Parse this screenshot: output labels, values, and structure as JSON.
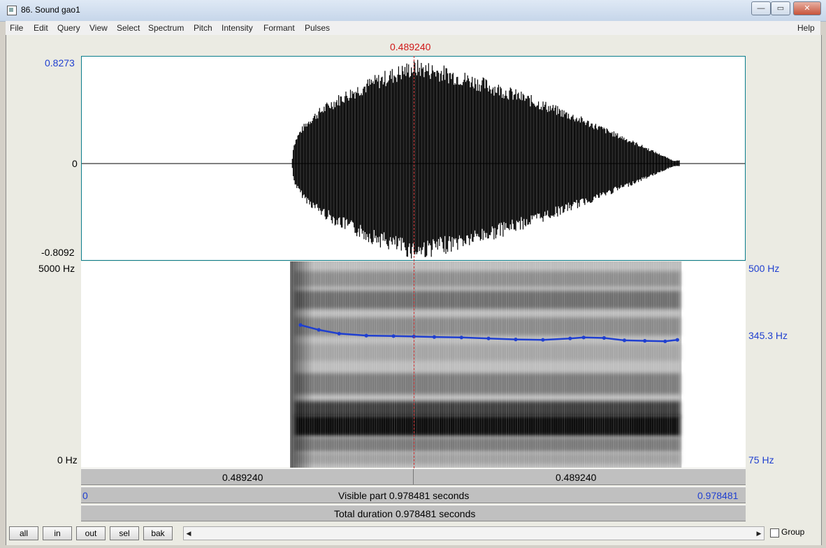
{
  "window": {
    "title": "86. Sound gao1",
    "controls": [
      "—",
      "▭",
      "✕"
    ]
  },
  "menu": {
    "items": [
      "File",
      "Edit",
      "Query",
      "View",
      "Select",
      "Spectrum",
      "Pitch",
      "Intensity",
      "Formant",
      "Pulses"
    ],
    "help": "Help"
  },
  "cursor": {
    "time_label": "0.489240",
    "time": 0.48924,
    "color": "#d01818"
  },
  "waveform": {
    "y_max": "0.8273",
    "y_zero": "0",
    "y_min": "-0.8092",
    "voiced_start": 0.31,
    "voiced_end": 0.88
  },
  "spectrogram": {
    "freq_max_label": "5000 Hz",
    "freq_min_label": "0 Hz"
  },
  "pitch": {
    "top_label": "500 Hz",
    "current_label": "345.3 Hz",
    "bottom_label": "75 Hz",
    "color": "#1f3fd0"
  },
  "chart_data": {
    "type": "line",
    "series": [
      {
        "x": [
          0.323,
          0.35,
          0.38,
          0.42,
          0.46,
          0.49,
          0.52,
          0.56,
          0.6,
          0.64,
          0.68,
          0.72,
          0.74,
          0.77,
          0.8,
          0.83,
          0.86,
          0.878
        ],
        "values": [
          370,
          360,
          352,
          348,
          347,
          346,
          345,
          344,
          342,
          340,
          339,
          342,
          344,
          343,
          338,
          337,
          336,
          339
        ]
      }
    ],
    "xlim": [
      0,
      0.978481
    ],
    "ylim": [
      75,
      500
    ]
  },
  "time_bar": {
    "left": "0.489240",
    "right": "0.489240"
  },
  "visible_bar": {
    "start": "0",
    "label": "Visible part 0.978481 seconds",
    "end": "0.978481"
  },
  "total_bar": {
    "label": "Total duration 0.978481 seconds"
  },
  "buttons": {
    "all": "all",
    "in": "in",
    "out": "out",
    "sel": "sel",
    "bak": "bak"
  },
  "group_label": "Group"
}
